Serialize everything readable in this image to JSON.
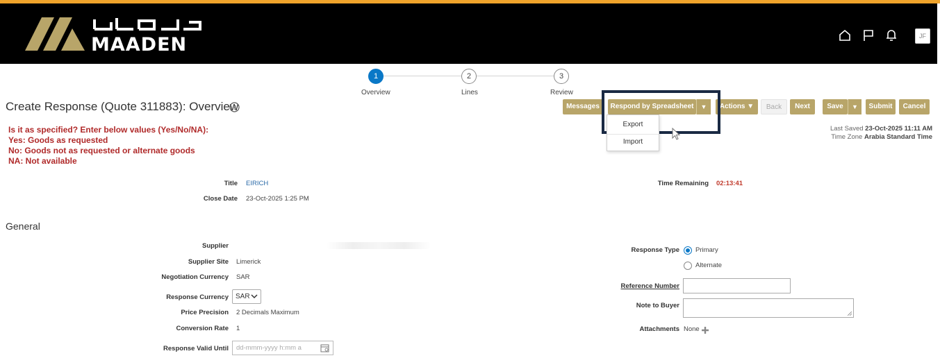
{
  "brand": {
    "arabic_name": "معادن",
    "name": "MAADEN"
  },
  "header": {
    "user_initials": "JF"
  },
  "train": {
    "steps": [
      {
        "number": "1",
        "label": "Overview",
        "active": true
      },
      {
        "number": "2",
        "label": "Lines",
        "active": false
      },
      {
        "number": "3",
        "label": "Review",
        "active": false
      }
    ]
  },
  "page": {
    "title": "Create Response (Quote 311883): Overview"
  },
  "toolbar": {
    "messages": "Messages",
    "respond_by_spreadsheet": "Respond by Spreadsheet",
    "actions": "Actions",
    "back": "Back",
    "next": "Next",
    "save": "Save",
    "submit": "Submit",
    "cancel": "Cancel"
  },
  "spreadsheet_menu": {
    "items": [
      "Export",
      "Import"
    ]
  },
  "instructions": [
    "Is it as specified? Enter below values (Yes/No/NA):",
    "Yes: Goods as requested",
    "No: Goods not as requested or alternate goods",
    "NA: Not available"
  ],
  "status": {
    "last_saved_label": "Last Saved",
    "last_saved_value": "23-Oct-2025 11:11 AM",
    "time_zone_label": "Time Zone",
    "time_zone_value": "Arabia Standard Time"
  },
  "overview": {
    "title_label": "Title",
    "title_value": "EIRICH",
    "close_date_label": "Close Date",
    "close_date_value": "23-Oct-2025 1:25 PM",
    "time_remaining_label": "Time Remaining",
    "time_remaining_value": "02:13:41"
  },
  "general": {
    "section_title": "General",
    "supplier_label": "Supplier",
    "supplier_site_label": "Supplier Site",
    "supplier_site_value": "Limerick",
    "negotiation_currency_label": "Negotiation Currency",
    "negotiation_currency_value": "SAR",
    "response_currency_label": "Response Currency",
    "response_currency_value": "SAR",
    "price_precision_label": "Price Precision",
    "price_precision_value": "2 Decimals Maximum",
    "conversion_rate_label": "Conversion Rate",
    "conversion_rate_value": "1",
    "response_valid_until_label": "Response Valid Until",
    "response_valid_until_placeholder": "dd-mmm-yyyy h:mm a",
    "response_type_label": "Response Type",
    "response_type_primary": "Primary",
    "response_type_alternate": "Alternate",
    "reference_number_label": "Reference Number",
    "note_to_buyer_label": "Note to Buyer",
    "attachments_label": "Attachments",
    "attachments_value": "None"
  },
  "colors": {
    "accent_gold": "#b8a569",
    "header_bg": "#000000",
    "top_stripe": "#f0a42b",
    "train_active": "#0a78c7",
    "instruction_red": "#b02a2a",
    "highlight_frame": "#1a2a44"
  }
}
